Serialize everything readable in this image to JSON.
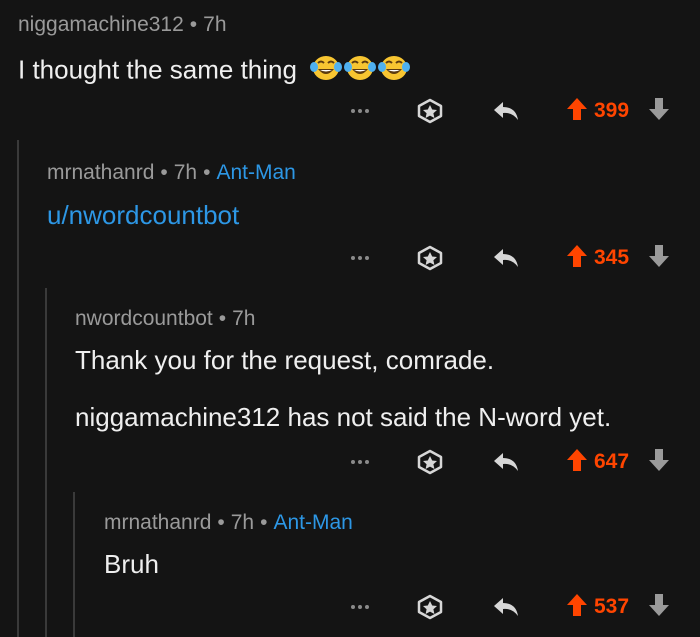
{
  "comments": [
    {
      "author": "niggamachine312",
      "separator": "•",
      "age": "7h",
      "flair": "",
      "lines": [
        "I thought the same thing"
      ],
      "emojis": [
        "face-with-tears-of-joy",
        "face-with-tears-of-joy",
        "face-with-tears-of-joy"
      ],
      "score": "399"
    },
    {
      "author": "mrnathanrd",
      "separator": "•",
      "age": "7h",
      "flair": "Ant-Man",
      "lines": [
        "u/nwordcountbot"
      ],
      "score": "345"
    },
    {
      "author": "nwordcountbot",
      "separator": "•",
      "age": "7h",
      "flair": "",
      "lines": [
        "Thank you for the request, comrade.",
        "niggamachine312 has not said the N-word yet."
      ],
      "score": "647"
    },
    {
      "author": "mrnathanrd",
      "separator": "•",
      "age": "7h",
      "flair": "Ant-Man",
      "lines": [
        "Bruh"
      ],
      "score": "537"
    }
  ],
  "colors": {
    "background": "#141414",
    "upvote": "#ff4500",
    "flair": "#2d97e5",
    "meta": "#9a9a9a"
  },
  "icons": [
    "more-icon",
    "award-icon",
    "reply-icon",
    "upvote-icon",
    "downvote-icon"
  ]
}
